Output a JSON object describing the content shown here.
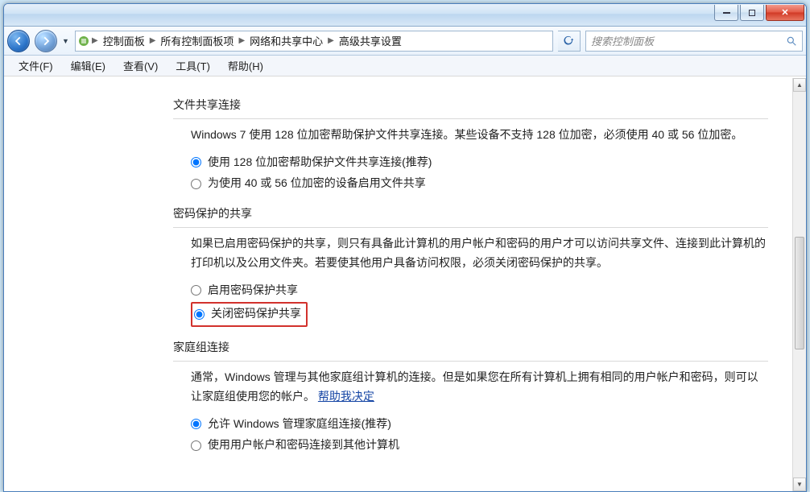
{
  "breadcrumbs": {
    "b1": "控制面板",
    "b2": "所有控制面板项",
    "b3": "网络和共享中心",
    "b4": "高级共享设置"
  },
  "search": {
    "placeholder": "搜索控制面板"
  },
  "menu": {
    "file": "文件(F)",
    "edit": "编辑(E)",
    "view": "查看(V)",
    "tools": "工具(T)",
    "help": "帮助(H)"
  },
  "sections": {
    "file_sharing": {
      "title": "文件共享连接",
      "desc": "Windows 7 使用 128 位加密帮助保护文件共享连接。某些设备不支持 128 位加密，必须使用 40 或 56 位加密。",
      "opt1": "使用 128 位加密帮助保护文件共享连接(推荐)",
      "opt2": "为使用 40 或 56 位加密的设备启用文件共享"
    },
    "password": {
      "title": "密码保护的共享",
      "desc": "如果已启用密码保护的共享，则只有具备此计算机的用户帐户和密码的用户才可以访问共享文件、连接到此计算机的打印机以及公用文件夹。若要使其他用户具备访问权限，必须关闭密码保护的共享。",
      "opt1": "启用密码保护共享",
      "opt2": "关闭密码保护共享"
    },
    "homegroup": {
      "title": "家庭组连接",
      "desc_pre": "通常，Windows 管理与其他家庭组计算机的连接。但是如果您在所有计算机上拥有相同的用户帐户和密码，则可以让家庭组使用您的帐户。",
      "help_link": "帮助我决定",
      "opt1": "允许 Windows 管理家庭组连接(推荐)",
      "opt2": "使用用户帐户和密码连接到其他计算机"
    }
  }
}
